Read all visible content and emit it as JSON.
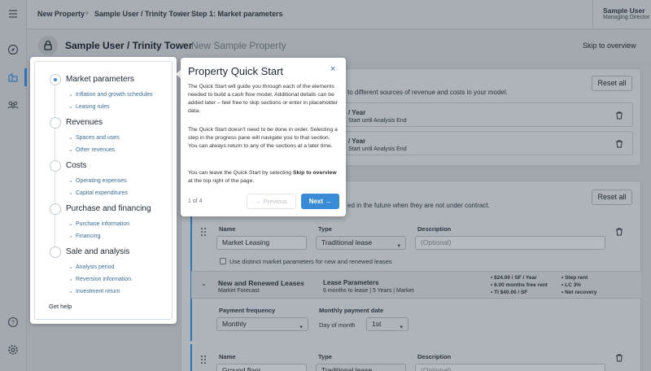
{
  "breadcrumbs": [
    "New Property",
    "Sample User / Trinity Tower",
    "Step 1: Market parameters"
  ],
  "user": {
    "name": "Sample User",
    "role": "Managing Director"
  },
  "page": {
    "title": "Sample User / Trinity Tower",
    "subtitle": "New Sample Property",
    "skip_label": "Skip to overview"
  },
  "background": {
    "intro_text": "to different sources of revenue and costs in your model.",
    "reset_label": "Reset all",
    "rows": [
      {
        "line1": "/ Year",
        "line2": "Start until Analysis End"
      },
      {
        "line1": "/ Year",
        "line2": "Start until Analysis End"
      }
    ],
    "section2_text": "ed in the future when they are not under contract.",
    "reset2_label": "Reset all",
    "labels": {
      "name": "Name",
      "type": "Type",
      "description": "Description"
    },
    "lease1": {
      "name": "Market Leasing",
      "type": "Traditional lease",
      "description_placeholder": "(Optional)"
    },
    "checkbox_label": "Use distinct market parameters for new and renewed leases",
    "summary": {
      "title": "New and Renewed Leases",
      "subtitle": "Market Forecast",
      "params_title": "Lease Parameters",
      "params_sub": "6 months to lease | 5 Years | Market",
      "bullets_a": [
        "$24.00 / SF / Year",
        "6.00 months free rent",
        "TI $40.00 / SF"
      ],
      "bullets_b": [
        "Step rent",
        "LC 3%",
        "Net recovery"
      ]
    },
    "payment": {
      "freq_label": "Payment frequency",
      "freq_value": "Monthly",
      "date_label": "Monthly payment date",
      "day_label": "Day of month",
      "day_value": "1st"
    },
    "lease2": {
      "name": "Ground floor",
      "type": "Traditional lease",
      "description_placeholder": "(Optional)"
    }
  },
  "progress": {
    "steps": [
      {
        "label": "Market parameters",
        "subs": [
          "Inflation and growth schedules",
          "Leasing rules"
        ]
      },
      {
        "label": "Revenues",
        "subs": [
          "Spaces and uses",
          "Other revenues"
        ]
      },
      {
        "label": "Costs",
        "subs": [
          "Operating expenses",
          "Capital expenditures"
        ]
      },
      {
        "label": "Purchase and financing",
        "subs": [
          "Purchase information",
          "Financing"
        ]
      },
      {
        "label": "Sale and analysis",
        "subs": [
          "Analysis period",
          "Reversion information",
          "Investment return"
        ]
      }
    ],
    "help": "Get help"
  },
  "popover": {
    "title": "Property Quick Start",
    "p1": "The Quick Start will guide you through each of the elements needed to build a cash flow model. Additional details can be added later – feel free to skip sections or enter in placeholder data.",
    "p2": "The Quick Start doesn't need to be done in order. Selecting a step in the progress pane will navigate you to that section. You can always return to any of the sections at a later time.",
    "p3a": "You can leave the Quick Start by selecting ",
    "p3b": "Skip to overview",
    "p3c": " at the top right of the page.",
    "counter": "1 of 4",
    "prev": "← Previous",
    "next": "Next →"
  },
  "colors": {
    "accent": "#3a8bd6",
    "brand_blue": "#2f74b5"
  }
}
